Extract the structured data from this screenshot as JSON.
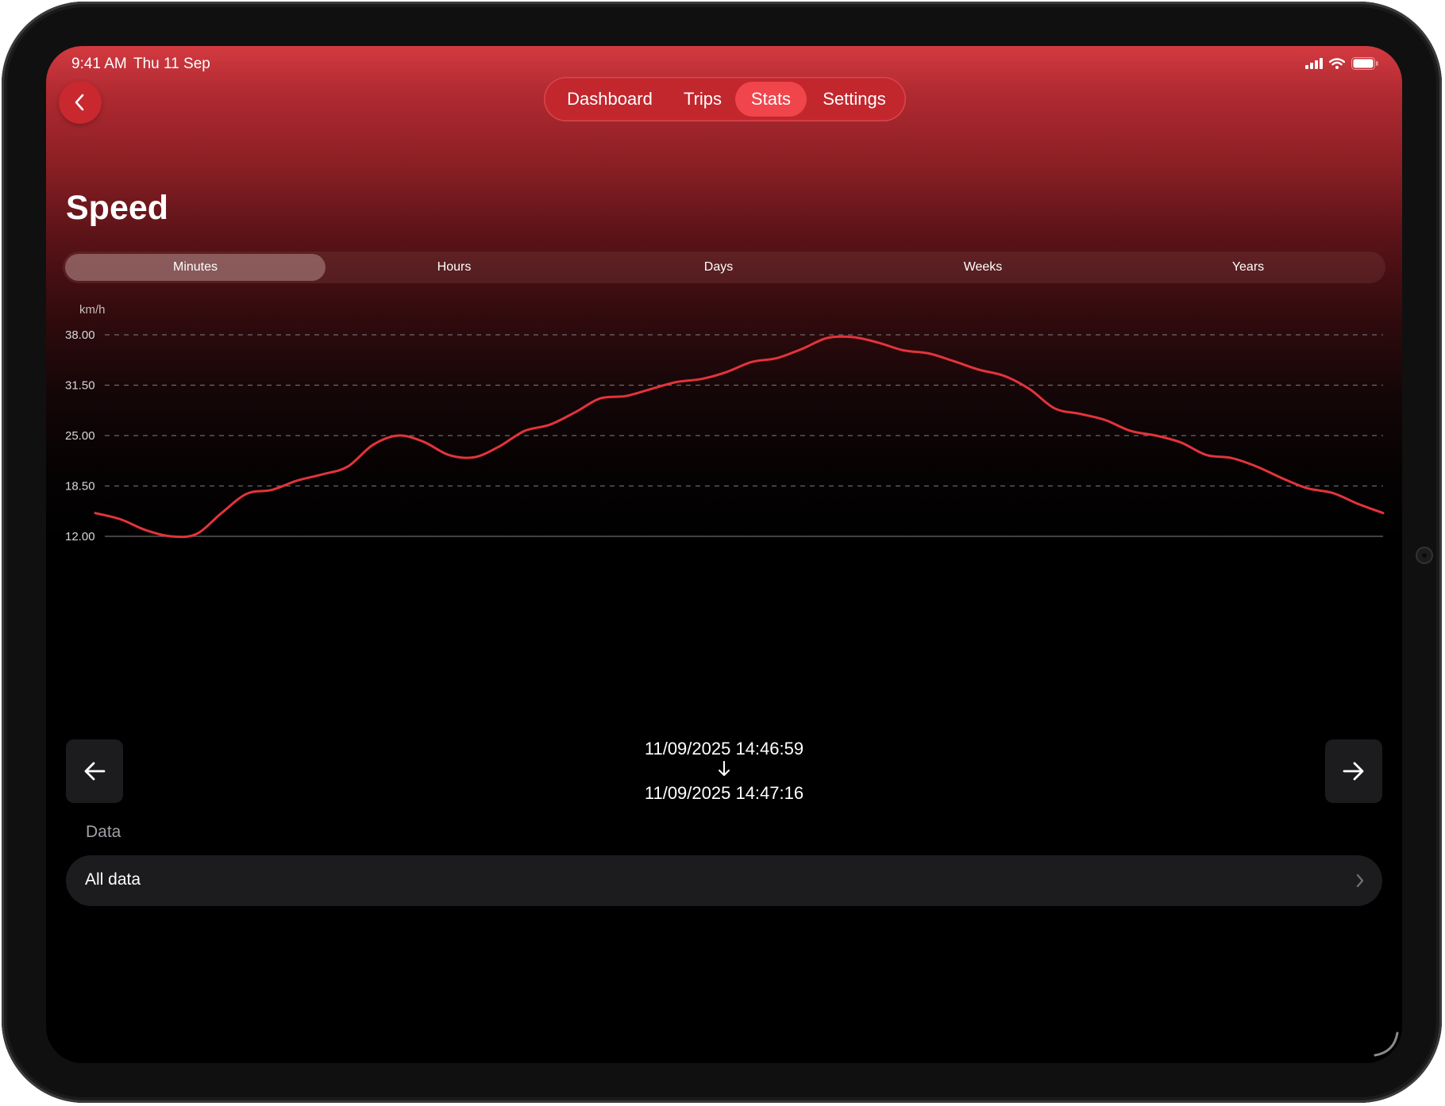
{
  "status_bar": {
    "time": "9:41 AM",
    "date": "Thu 11 Sep"
  },
  "nav": {
    "tabs": [
      "Dashboard",
      "Trips",
      "Stats",
      "Settings"
    ],
    "active": "Stats"
  },
  "page": {
    "title": "Speed"
  },
  "range": {
    "options": [
      "Minutes",
      "Hours",
      "Days",
      "Weeks",
      "Years"
    ],
    "selected": "Minutes"
  },
  "period": {
    "start": "11/09/2025 14:46:59",
    "end": "11/09/2025 14:47:16"
  },
  "data_section": {
    "heading": "Data",
    "row_label": "All data"
  },
  "colors": {
    "accent": "#e3343b",
    "line": "#e3343b"
  },
  "chart_data": {
    "type": "line",
    "ylabel": "km/h",
    "ylim": [
      12,
      38
    ],
    "y_ticks": [
      "38.00",
      "31.50",
      "25.00",
      "18.50",
      "12.00"
    ],
    "grid": true,
    "series": [
      {
        "values": [
          15,
          14.2,
          12.8,
          12.0,
          12.3,
          15.0,
          17.5,
          18.0,
          19.2,
          20.0,
          21.0,
          23.8,
          25.0,
          24.2,
          22.5,
          22.2,
          23.6,
          25.6,
          26.4,
          28.0,
          29.8,
          30.1,
          31.0,
          31.9,
          32.3,
          33.2,
          34.5,
          35.0,
          36.2,
          37.6,
          37.7,
          37.0,
          36.0,
          35.6,
          34.6,
          33.5,
          32.7,
          31.0,
          28.5,
          27.8,
          27.0,
          25.6,
          25.0,
          24.1,
          22.5,
          22.1,
          21.0,
          19.5,
          18.2,
          17.6,
          16.2,
          15.0
        ]
      }
    ]
  }
}
